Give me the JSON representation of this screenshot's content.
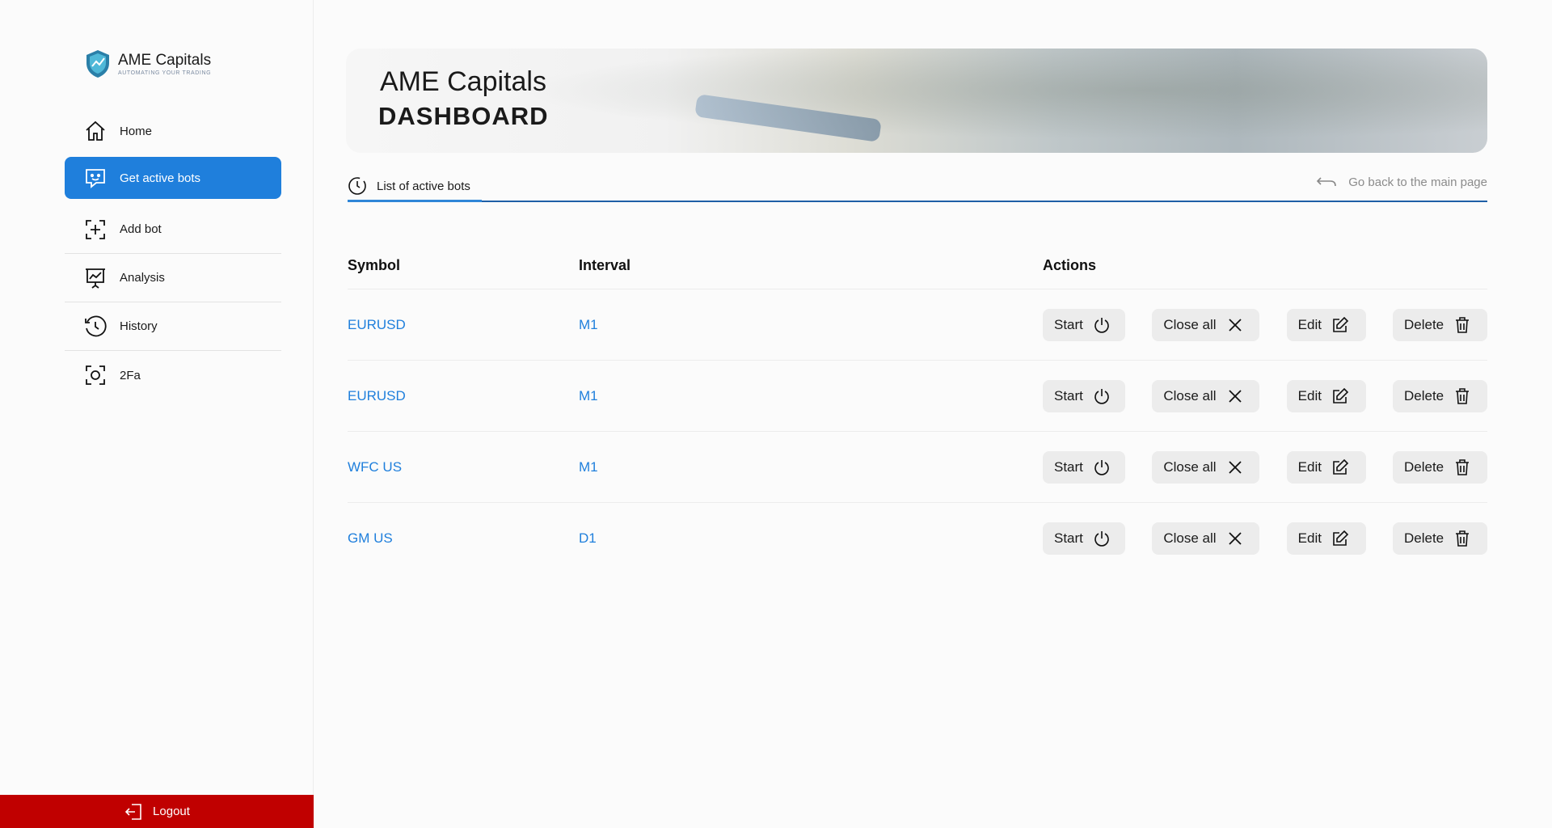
{
  "brand": {
    "name": "AME Capitals",
    "tagline": "AUTOMATING YOUR TRADING"
  },
  "sidebar": {
    "items": [
      {
        "label": "Home",
        "icon": "home-icon"
      },
      {
        "label": "Get active bots",
        "icon": "chat-bot-icon",
        "active": true
      },
      {
        "label": "Add bot",
        "icon": "add-frame-icon"
      },
      {
        "label": "Analysis",
        "icon": "presentation-chart-icon"
      },
      {
        "label": "History",
        "icon": "history-clock-icon"
      },
      {
        "label": "2Fa",
        "icon": "scan-focus-icon"
      }
    ],
    "logout": "Logout"
  },
  "hero": {
    "title": "AME Capitals",
    "subtitle": "DASHBOARD"
  },
  "tabs": {
    "active_label": "List of active bots",
    "back_label": "Go back to the main page"
  },
  "table": {
    "headers": {
      "symbol": "Symbol",
      "interval": "Interval",
      "actions": "Actions"
    },
    "rows": [
      {
        "symbol": "EURUSD",
        "interval": "M1"
      },
      {
        "symbol": "EURUSD",
        "interval": "M1"
      },
      {
        "symbol": "WFC US",
        "interval": "M1"
      },
      {
        "symbol": "GM US",
        "interval": "D1"
      }
    ],
    "actions": {
      "start": "Start",
      "close_all": "Close all",
      "edit": "Edit",
      "delete": "Delete"
    }
  },
  "colors": {
    "accent": "#1f7fdc",
    "logout": "#c00000",
    "tab_line": "#1f5fa6"
  }
}
